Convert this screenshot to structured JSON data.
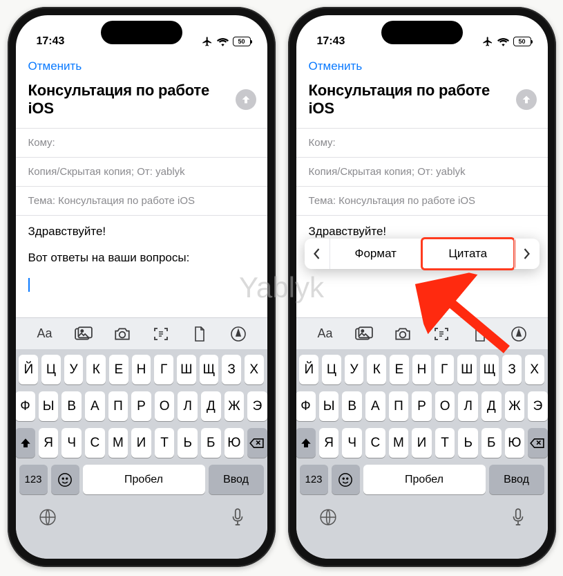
{
  "watermark": "Yablyk",
  "status": {
    "time": "17:43",
    "battery": "50"
  },
  "nav": {
    "cancel": "Отменить"
  },
  "compose": {
    "subject_title": "Консультация по работе iOS",
    "to_label": "Кому:",
    "cc_label": "Копия/Скрытая копия; От:",
    "cc_value": "yablyk",
    "subject_label": "Тема:",
    "subject_value": "Консультация по работе iOS",
    "body_line1": "Здравствуйте!",
    "body_line2": "Вот ответы на ваши вопросы:"
  },
  "popup": {
    "format": "Формат",
    "quote": "Цитата"
  },
  "keyboard": {
    "row1": [
      "Й",
      "Ц",
      "У",
      "К",
      "Е",
      "Н",
      "Г",
      "Ш",
      "Щ",
      "З",
      "Х"
    ],
    "row2": [
      "Ф",
      "Ы",
      "В",
      "А",
      "П",
      "Р",
      "О",
      "Л",
      "Д",
      "Ж",
      "Э"
    ],
    "row3": [
      "Я",
      "Ч",
      "С",
      "М",
      "И",
      "Т",
      "Ь",
      "Б",
      "Ю"
    ],
    "k123": "123",
    "space": "Пробел",
    "enter": "Ввод"
  },
  "toolbar_icons": [
    "font",
    "photos",
    "camera",
    "scan",
    "document",
    "markup"
  ]
}
